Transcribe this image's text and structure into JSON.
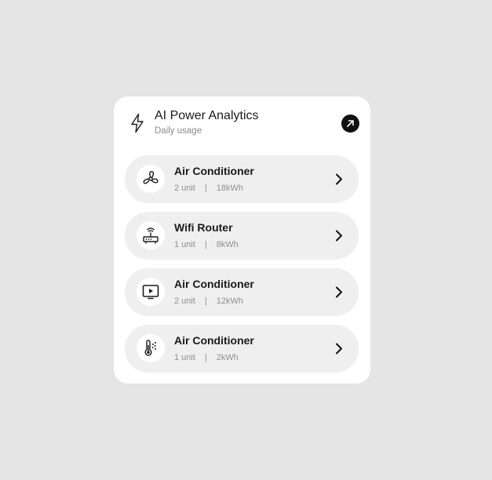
{
  "header": {
    "title": "AI Power Analytics",
    "subtitle": "Daily usage",
    "icon": "lightning-bolt-icon",
    "action_icon": "arrow-up-right-icon"
  },
  "devices": [
    {
      "name": "Air Conditioner",
      "units": "2 unit",
      "separator": "|",
      "energy": "18kWh",
      "icon": "fan-icon"
    },
    {
      "name": "Wifi Router",
      "units": "1 unit",
      "separator": "|",
      "energy": "8kWh",
      "icon": "router-icon"
    },
    {
      "name": "Air Conditioner",
      "units": "2 unit",
      "separator": "|",
      "energy": "12kWh",
      "icon": "tv-play-icon"
    },
    {
      "name": "Air Conditioner",
      "units": "1 unit",
      "separator": "|",
      "energy": "2kWh",
      "icon": "thermometer-icon"
    }
  ],
  "colors": {
    "background": "#e5e5e5",
    "card": "#ffffff",
    "item_background": "#efefef",
    "accent": "#111111",
    "muted_text": "#8f8f8f"
  }
}
